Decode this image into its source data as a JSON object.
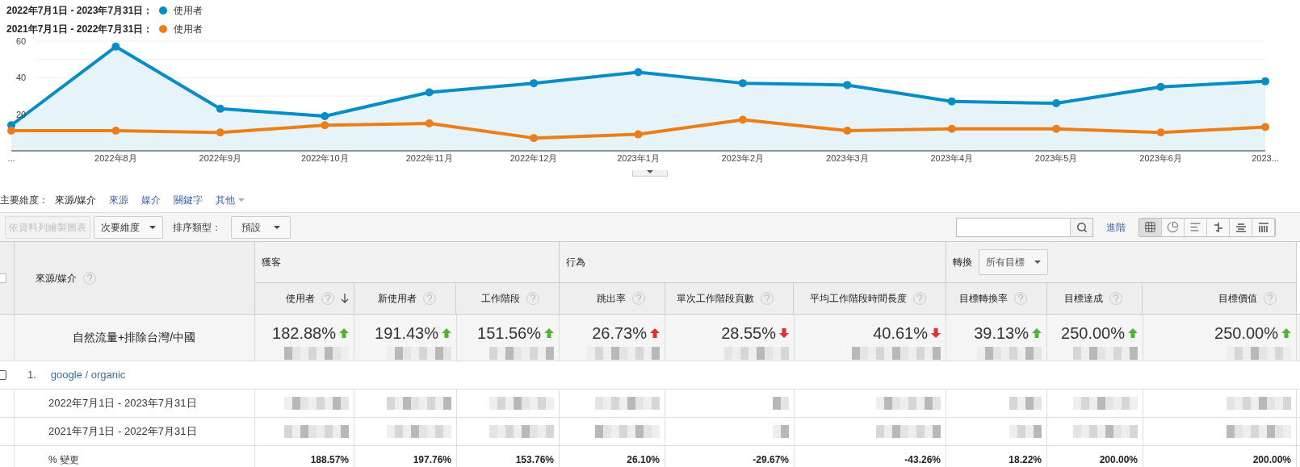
{
  "legend": [
    {
      "period": "2022年7月1日 - 2023年7月31日："
    },
    {
      "period": "2021年7月1日 - 2022年7月31日："
    }
  ],
  "chart_data": {
    "type": "line",
    "categories": [
      "...",
      "2022年8月",
      "2022年9月",
      "2022年10月",
      "2022年11月",
      "2022年12月",
      "2023年1月",
      "2023年2月",
      "2023年3月",
      "2023年4月",
      "2023年5月",
      "2023年6月",
      "2023..."
    ],
    "ylim": [
      0,
      60
    ],
    "yticks": [
      20,
      40,
      60
    ],
    "series": [
      {
        "name": "使用者",
        "type": "area",
        "marker": true,
        "color": "#058dc7",
        "values": [
          14,
          57,
          23,
          19,
          32,
          37,
          43,
          37,
          36,
          27,
          26,
          35,
          38
        ]
      },
      {
        "name": "使用者",
        "type": "line",
        "marker": true,
        "color": "#ed7e17",
        "values": [
          11,
          11,
          10,
          14,
          15,
          7,
          9,
          17,
          11,
          12,
          12,
          10,
          13
        ]
      }
    ]
  },
  "primary_dimension": {
    "label": "主要維度：",
    "options": [
      {
        "label": "來源/媒介",
        "selected": true
      },
      {
        "label": "來源",
        "selected": false
      },
      {
        "label": "媒介",
        "selected": false
      },
      {
        "label": "關鍵字",
        "selected": false
      }
    ],
    "more": "其他"
  },
  "toolbar": {
    "plot_rows": {
      "label": "依資料列繪製圖表",
      "disabled": true
    },
    "secondary_dimension": "次要維度",
    "sort_label": "排序類型：",
    "sort_value": "預設",
    "advanced": "進階",
    "views": [
      {
        "kind": "table",
        "selected": true
      },
      {
        "kind": "pie",
        "selected": false
      },
      {
        "kind": "bars",
        "selected": false
      },
      {
        "kind": "compare",
        "selected": false
      },
      {
        "kind": "terms",
        "selected": false
      },
      {
        "kind": "pivot",
        "selected": false
      }
    ]
  },
  "table": {
    "select_all_checked": false,
    "dimension_header": "來源/媒介",
    "groups": [
      {
        "label": "獲客",
        "columns": [
          {
            "label": "使用者",
            "sorted": true
          },
          {
            "label": "新使用者",
            "sorted": false
          },
          {
            "label": "工作階段",
            "sorted": false
          }
        ]
      },
      {
        "label": "行為",
        "columns": [
          {
            "label": "跳出率",
            "sorted": false
          },
          {
            "label": "單次工作階段頁數",
            "sorted": false
          },
          {
            "label": "平均工作階段時間長度",
            "sorted": false
          }
        ]
      },
      {
        "label": "轉換",
        "dropdown": "所有目標",
        "columns": [
          {
            "label": "目標轉換率",
            "sorted": false
          },
          {
            "label": "目標達成",
            "sorted": false
          },
          {
            "label": "目標價值",
            "sorted": false
          }
        ]
      }
    ],
    "summary": {
      "label": "自然流量+排除台灣/中國",
      "values": [
        {
          "value": "182.88%",
          "rising": true,
          "favorable": true
        },
        {
          "value": "191.43%",
          "rising": true,
          "favorable": true
        },
        {
          "value": "151.56%",
          "rising": true,
          "favorable": true
        },
        {
          "value": "26.73%",
          "rising": true,
          "favorable": false
        },
        {
          "value": "28.55%",
          "rising": false,
          "favorable": false
        },
        {
          "value": "40.61%",
          "rising": false,
          "favorable": false
        },
        {
          "value": "39.13%",
          "rising": true,
          "favorable": true
        },
        {
          "value": "250.00%",
          "rising": true,
          "favorable": true
        },
        {
          "value": "250.00%",
          "rising": true,
          "favorable": true
        }
      ]
    },
    "rows": [
      {
        "kind": "source",
        "index": "1.",
        "label": "google / organic",
        "checked": false
      },
      {
        "kind": "period",
        "label": "2022年7月1日 - 2023年7月31日"
      },
      {
        "kind": "period",
        "label": "2021年7月1日 - 2022年7月31日"
      },
      {
        "kind": "change",
        "label": "% 變更",
        "values": [
          "188.57%",
          "197.76%",
          "153.76%",
          "26.10%",
          "-29.67%",
          "-43.26%",
          "18.22%",
          "200.00%",
          "200.00%"
        ]
      }
    ]
  }
}
